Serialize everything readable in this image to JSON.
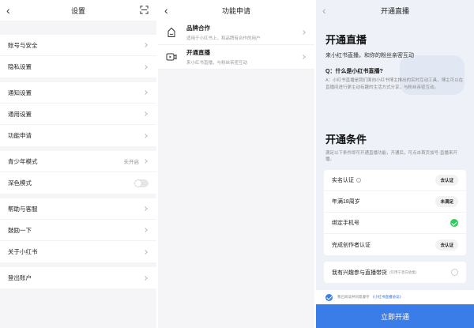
{
  "settings": {
    "title": "设置",
    "items": [
      {
        "label": "账号与安全"
      },
      {
        "label": "隐私设置"
      },
      {
        "label": "通知设置"
      },
      {
        "label": "通用设置"
      },
      {
        "label": "功能申请"
      },
      {
        "label": "青少年模式",
        "value": "未开启"
      },
      {
        "label": "深色模式"
      },
      {
        "label": "帮助与客服"
      },
      {
        "label": "鼓励一下"
      },
      {
        "label": "关于小红书"
      },
      {
        "label": "登出账户"
      }
    ]
  },
  "features": {
    "title": "功能申请",
    "items": [
      {
        "title": "品牌合作",
        "desc": "适用于小红书上，和品牌有合作的用户"
      },
      {
        "title": "开通直播",
        "desc": "来小红书直播，与粉丝亲密互动"
      }
    ]
  },
  "live": {
    "title": "开通直播",
    "hero_title": "开通直播",
    "hero_sub": "来小红书直播，和你的粉丝亲密互动",
    "q_title": "Q：什么是小红书直播?",
    "q_answer": "A：小红书直播是我们面向小红书博主推出的实时互动工具，博主可以在直播间进行更主动有趣的生活方式分享，与粉丝亲密互动。",
    "cond_title": "开通条件",
    "cond_desc": "满足以下条件即可开通直播功能，开通后，可点击首页加号-直播来开播。",
    "conditions": [
      {
        "label": "实名认证",
        "status": "去认证"
      },
      {
        "label": "年满18周岁",
        "status": "未满足"
      },
      {
        "label": "绑定手机号",
        "status": ""
      },
      {
        "label": "完成创作者认证",
        "status": "去认证"
      }
    ],
    "interest_label": "我有兴趣参与直播带货",
    "interest_note": "(仅用于意向收集)",
    "agree_text": "我已阅读并同意遵守",
    "agree_link": "《小红书直播协议》",
    "cta": "立即开通"
  }
}
